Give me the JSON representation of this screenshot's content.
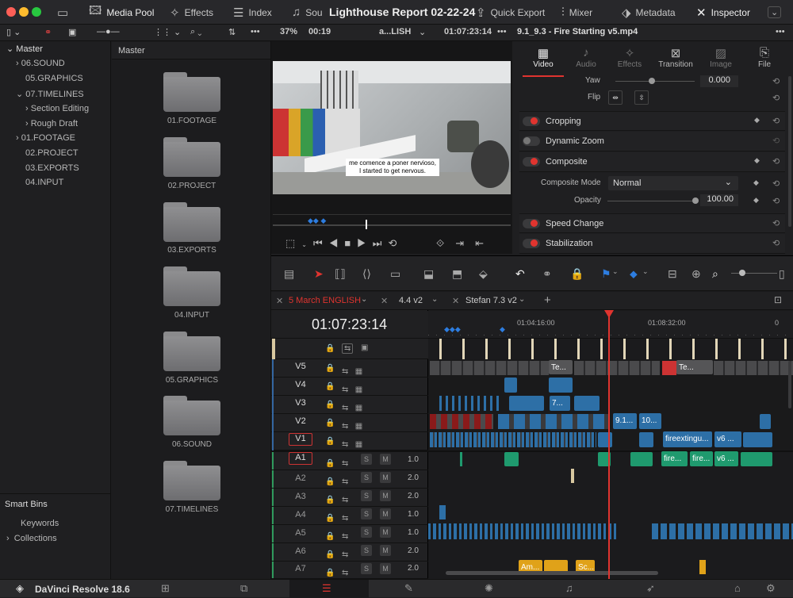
{
  "app": {
    "title": "Lighthouse Report 02-22-24",
    "name": "DaVinci Resolve 18.6"
  },
  "toolbar": {
    "media_pool": "Media Pool",
    "effects": "Effects",
    "index": "Index",
    "sound": "Sou",
    "quick_export": "Quick Export",
    "mixer": "Mixer",
    "metadata": "Metadata",
    "inspector": "Inspector"
  },
  "bar2": {
    "zoom": "37%",
    "tc_small": "00:19",
    "clip_name": "a...LISH",
    "timecode": "01:07:23:14",
    "file": "9.1_9.3 - Fire Starting v5.mp4"
  },
  "bins": {
    "root": "Master",
    "items": [
      "06.SOUND",
      "05.GRAPHICS",
      "07.TIMELINES",
      "Section Editing",
      "Rough Draft",
      "01.FOOTAGE",
      "02.PROJECT",
      "03.EXPORTS",
      "04.INPUT"
    ],
    "smart": "Smart Bins",
    "smart_items": [
      "Keywords",
      "Collections"
    ]
  },
  "pool": {
    "header": "Master",
    "folders": [
      "01.FOOTAGE",
      "02.PROJECT",
      "03.EXPORTS",
      "04.INPUT",
      "05.GRAPHICS",
      "06.SOUND",
      "07.TIMELINES"
    ]
  },
  "viewer": {
    "subtitle_line1": "me comence a poner nervioso,",
    "subtitle_line2": "I started to get nervous."
  },
  "inspector": {
    "tabs": [
      "Video",
      "Audio",
      "Effects",
      "Transition",
      "Image",
      "File"
    ],
    "yaw_label": "Yaw",
    "yaw_value": "0.000",
    "flip_label": "Flip",
    "cropping": "Cropping",
    "dynamic_zoom": "Dynamic Zoom",
    "composite": "Composite",
    "composite_mode_label": "Composite Mode",
    "composite_mode": "Normal",
    "opacity_label": "Opacity",
    "opacity_value": "100.00",
    "speed_change": "Speed Change",
    "stabilization": "Stabilization"
  },
  "timeline": {
    "tabs": [
      "5 March ENGLISH",
      "4.4 v2",
      "Stefan 7.3 v2"
    ],
    "timecode": "01:07:23:14",
    "ruler": [
      "01:04:16:00",
      "01:08:32:00"
    ],
    "video_tracks": [
      "V5",
      "V4",
      "V3",
      "V2",
      "V1"
    ],
    "audio_tracks": [
      "A1",
      "A2",
      "A3",
      "A4",
      "A5",
      "A6",
      "A7"
    ],
    "audio_vols": [
      "1.0",
      "2.0",
      "2.0",
      "1.0",
      "1.0",
      "2.0",
      "2.0"
    ],
    "clip_labels": {
      "v5a": "Te...",
      "v5b": "Te...",
      "v3": "7...",
      "v2a": "9.1...",
      "v2b": "10...",
      "v1a": "fireextingu...",
      "v1b": "v6 ...",
      "a1a": "fire...",
      "a1b": "fire...",
      "a1c": "v6 ...",
      "a7a": "Am...",
      "a7b": "Sc..."
    }
  },
  "colors": {
    "video_clip": "#2d6fa6",
    "audio_clip": "#1f9a6e",
    "playhead": "#e0342f",
    "accent": "#e0342f"
  }
}
